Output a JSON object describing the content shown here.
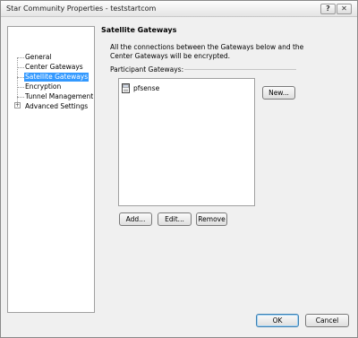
{
  "window": {
    "title": "Star Community Properties - teststartcom",
    "help_glyph": "?",
    "close_glyph": "✕"
  },
  "tree": {
    "items": [
      {
        "label": "General"
      },
      {
        "label": "Center Gateways"
      },
      {
        "label": "Satellite Gateways",
        "selected": true
      },
      {
        "label": "Encryption"
      },
      {
        "label": "Tunnel Management"
      },
      {
        "label": "Advanced Settings",
        "expandable": true
      }
    ],
    "expander_glyph": "+"
  },
  "panel": {
    "title": "Satellite Gateways",
    "description": "All the connections between the Gateways below and the Center Gateways will be encrypted.",
    "group_label": "Participant Gateways:",
    "gateways": [
      {
        "name": "pfsense",
        "icon": "gateway-icon"
      }
    ],
    "buttons": {
      "new": "New...",
      "add": "Add...",
      "edit": "Edit...",
      "remove": "Remove"
    }
  },
  "footer": {
    "ok": "OK",
    "cancel": "Cancel"
  },
  "colors": {
    "selection": "#3399ff",
    "background": "#f0f0f0",
    "default_button_border": "#3c7fb1"
  }
}
